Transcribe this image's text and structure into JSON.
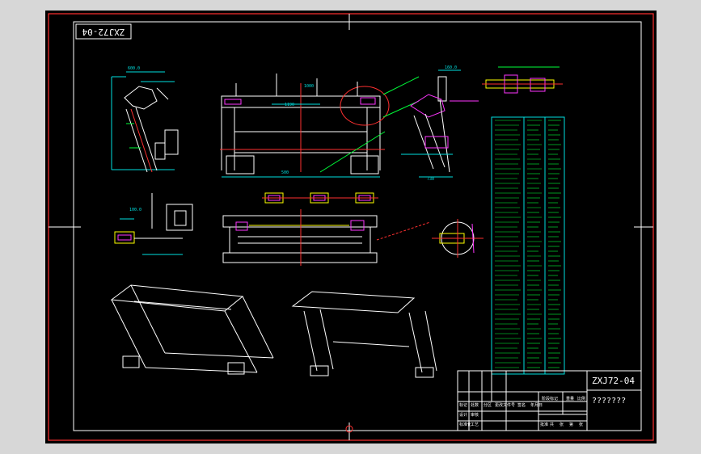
{
  "drawing": {
    "stamp_number": "ZXJ72-04",
    "title_block": {
      "drawing_number": "ZXJ72-04",
      "drawing_name": "???????",
      "labels": [
        "标记",
        "处数",
        "分区",
        "更改文件号",
        "签名",
        "年月日",
        "设计",
        "标准化",
        "阶段标记",
        "重量",
        "比例",
        "审核",
        "工艺",
        "批准",
        "共",
        "张",
        "第",
        "张"
      ]
    },
    "dimension_labels": [
      "600.0",
      "1190",
      "160.0",
      "1000",
      "500",
      "730",
      "100.0"
    ]
  },
  "colors": {
    "background": "#000000",
    "frame": "#ff0000",
    "linework": "#ffffff",
    "dimension": "#00e0e0",
    "green_callouts": "#00ff3a",
    "magenta": "#ff36ff",
    "yellow": "#ffff00"
  }
}
